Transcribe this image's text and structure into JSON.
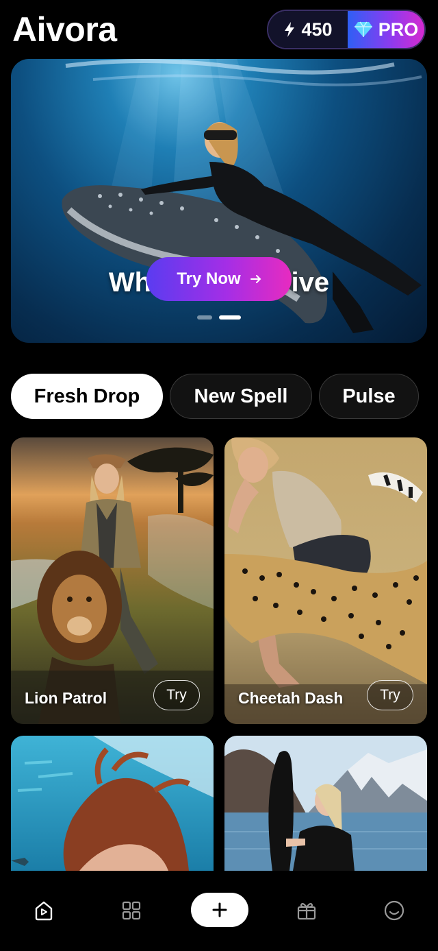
{
  "header": {
    "app_title": "Aivora",
    "credits": "450",
    "pro_label": "PRO"
  },
  "hero": {
    "title": "Whale Deep Dive",
    "cta_label": "Try Now",
    "cta_icon": "arrow-right-icon",
    "slide_count": 2,
    "active_slide": 2
  },
  "tabs": [
    {
      "label": "Fresh Drop",
      "active": true
    },
    {
      "label": "New Spell",
      "active": false
    },
    {
      "label": "Pulse",
      "active": false
    }
  ],
  "cards": [
    {
      "title": "Lion Patrol",
      "try_label": "Try"
    },
    {
      "title": "Cheetah Dash",
      "try_label": "Try"
    },
    {
      "title": "",
      "try_label": ""
    },
    {
      "title": "",
      "try_label": ""
    }
  ],
  "bottom_nav": {
    "items": [
      {
        "icon": "home-play-icon"
      },
      {
        "icon": "grid-icon"
      },
      {
        "icon": "plus-icon"
      },
      {
        "icon": "gift-icon"
      },
      {
        "icon": "smiley-icon"
      }
    ]
  },
  "colors": {
    "accent_gradient_start": "#5a3cf0",
    "accent_gradient_end": "#e72bc0",
    "pro_gradient_start": "#2f5ff5",
    "background": "#000000"
  }
}
